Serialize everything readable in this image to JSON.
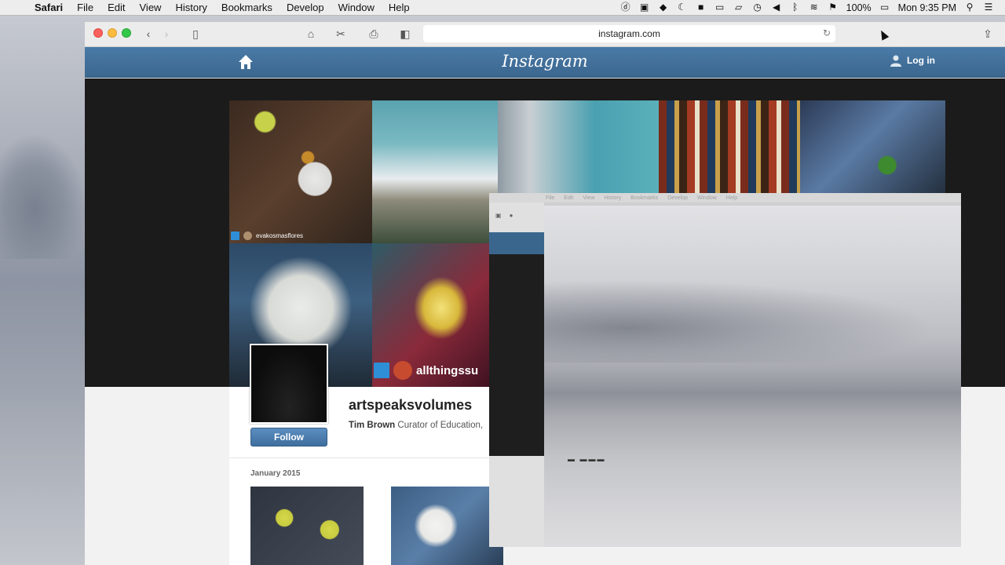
{
  "menubar": {
    "app_name": "Safari",
    "items": [
      "File",
      "Edit",
      "View",
      "History",
      "Bookmarks",
      "Develop",
      "Window",
      "Help"
    ],
    "battery": "100%",
    "clock": "Mon 9:35 PM"
  },
  "browser": {
    "url": "instagram.com"
  },
  "instagram": {
    "logo": "Instagram",
    "login_label": "Log in",
    "cover_tags": [
      "evakosmasflores",
      "allthingssu"
    ],
    "profile": {
      "username": "artspeaksvolumes",
      "bio_name": "Tim Brown",
      "bio_text": "Curator of Education,",
      "follow_label": "Follow"
    },
    "month_label": "January 2015"
  },
  "overlay": {
    "menu_items": [
      "File",
      "Edit",
      "View",
      "History",
      "Bookmarks",
      "Develop",
      "Window",
      "Help"
    ]
  },
  "colors": {
    "ig_header": "#3f6d97",
    "follow_button": "#4a7db0"
  },
  "icons": [
    "apple-icon",
    "home-icon",
    "user-icon",
    "reload-icon",
    "share-icon",
    "sidebar-icon"
  ]
}
